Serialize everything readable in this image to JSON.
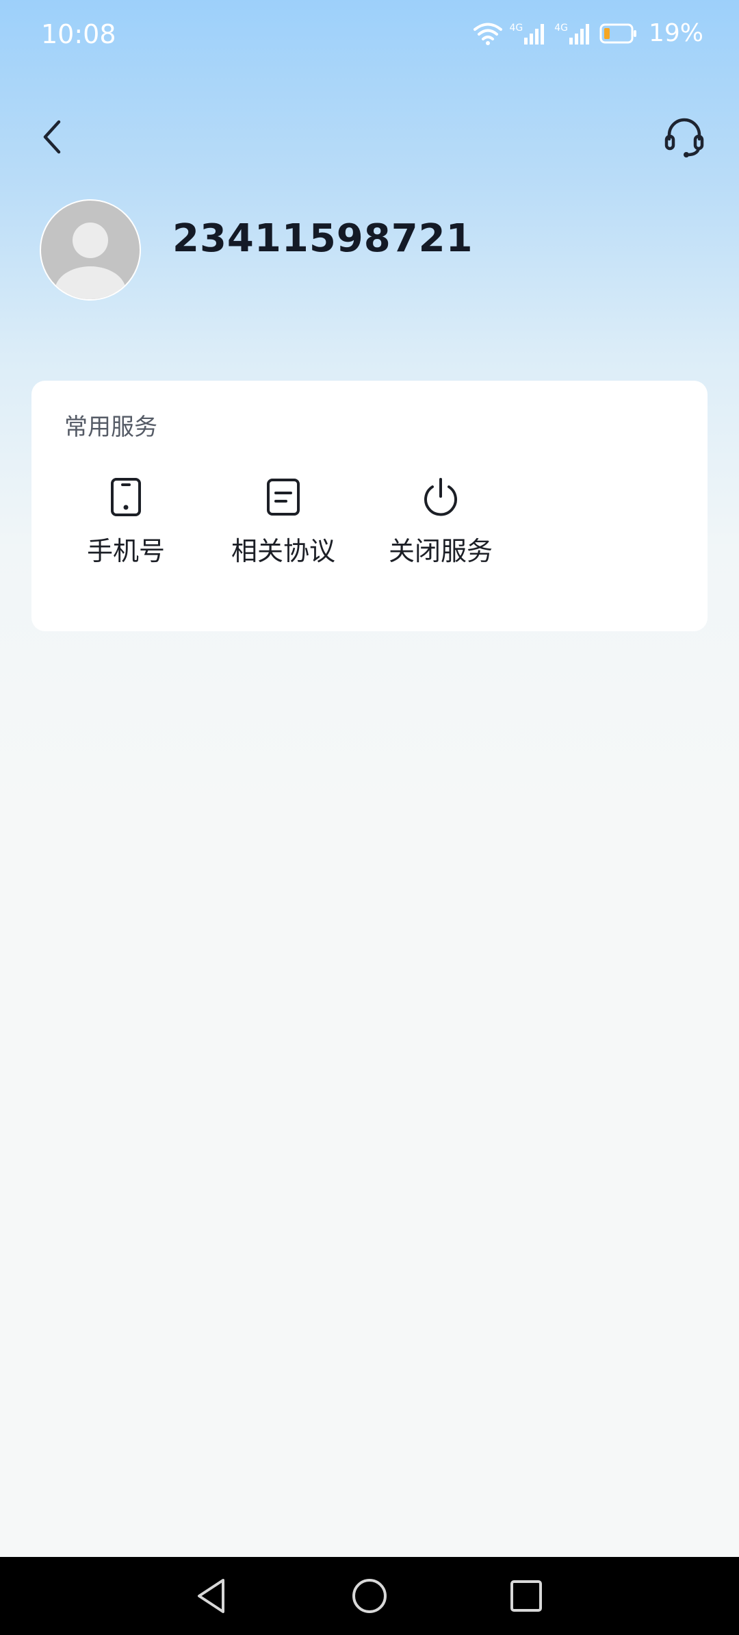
{
  "status_bar": {
    "time": "10:08",
    "network1": "4G",
    "network2": "4G",
    "battery": "19%"
  },
  "header": {
    "back_icon": "chevron-left-icon",
    "support_icon": "headset-icon"
  },
  "profile": {
    "account_id": "23411598721"
  },
  "services": {
    "title": "常用服务",
    "items": [
      {
        "label": "手机号",
        "icon": "phone-icon"
      },
      {
        "label": "相关协议",
        "icon": "document-icon"
      },
      {
        "label": "关闭服务",
        "icon": "power-icon"
      }
    ]
  },
  "colors": {
    "accent_text": "#141a26",
    "battery_low": "#f5a623"
  }
}
